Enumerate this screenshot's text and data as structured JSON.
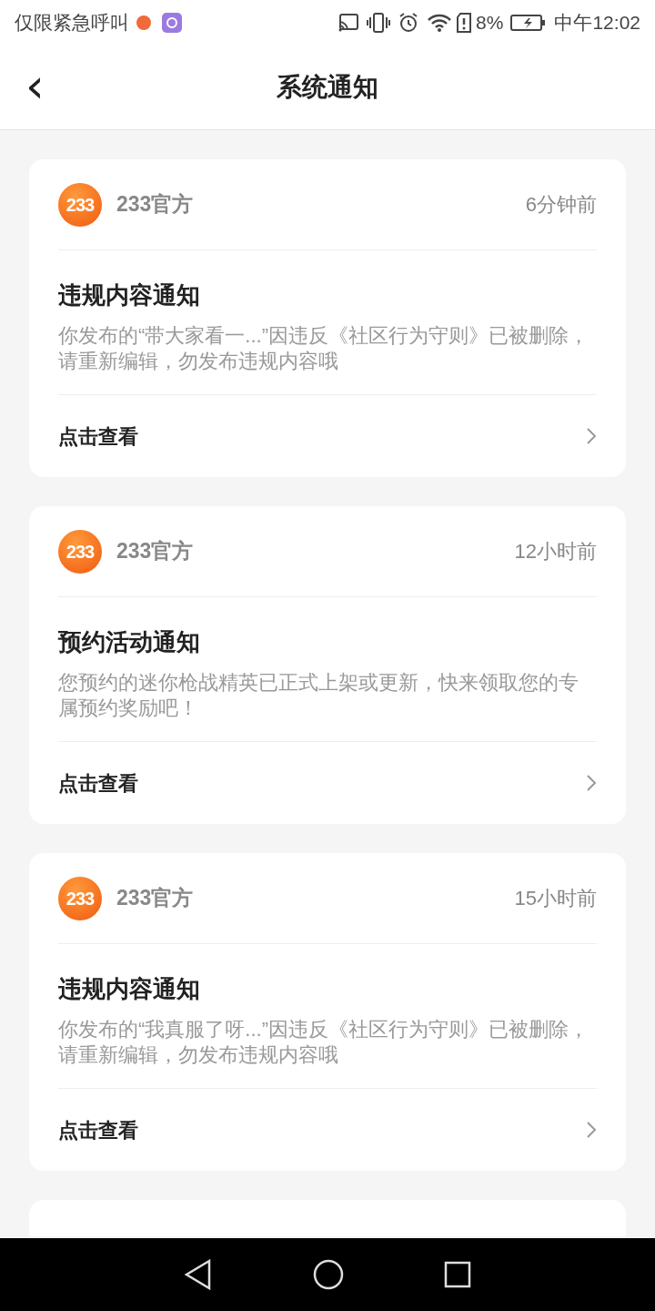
{
  "status_bar": {
    "carrier": "仅限紧急呼叫",
    "battery": "8%",
    "time": "中午12:02"
  },
  "header": {
    "back": "‹",
    "title": "系统通知"
  },
  "notifications": [
    {
      "logo_text": "233",
      "sender": "233官方",
      "time": "6分钟前",
      "title": "违规内容通知",
      "body": "你发布的“带大家看一...”因违反《社区行为守则》已被删除，请重新编辑，勿发布违规内容哦",
      "action": "点击查看"
    },
    {
      "logo_text": "233",
      "sender": "233官方",
      "time": "12小时前",
      "title": "预约活动通知",
      "body": "您预约的迷你枪战精英已正式上架或更新，快来领取您的专属预约奖励吧！",
      "action": "点击查看"
    },
    {
      "logo_text": "233",
      "sender": "233官方",
      "time": "15小时前",
      "title": "违规内容通知",
      "body": "你发布的“我真服了呀...”因违反《社区行为守则》已被删除，请重新编辑，勿发布违规内容哦",
      "action": "点击查看"
    }
  ]
}
